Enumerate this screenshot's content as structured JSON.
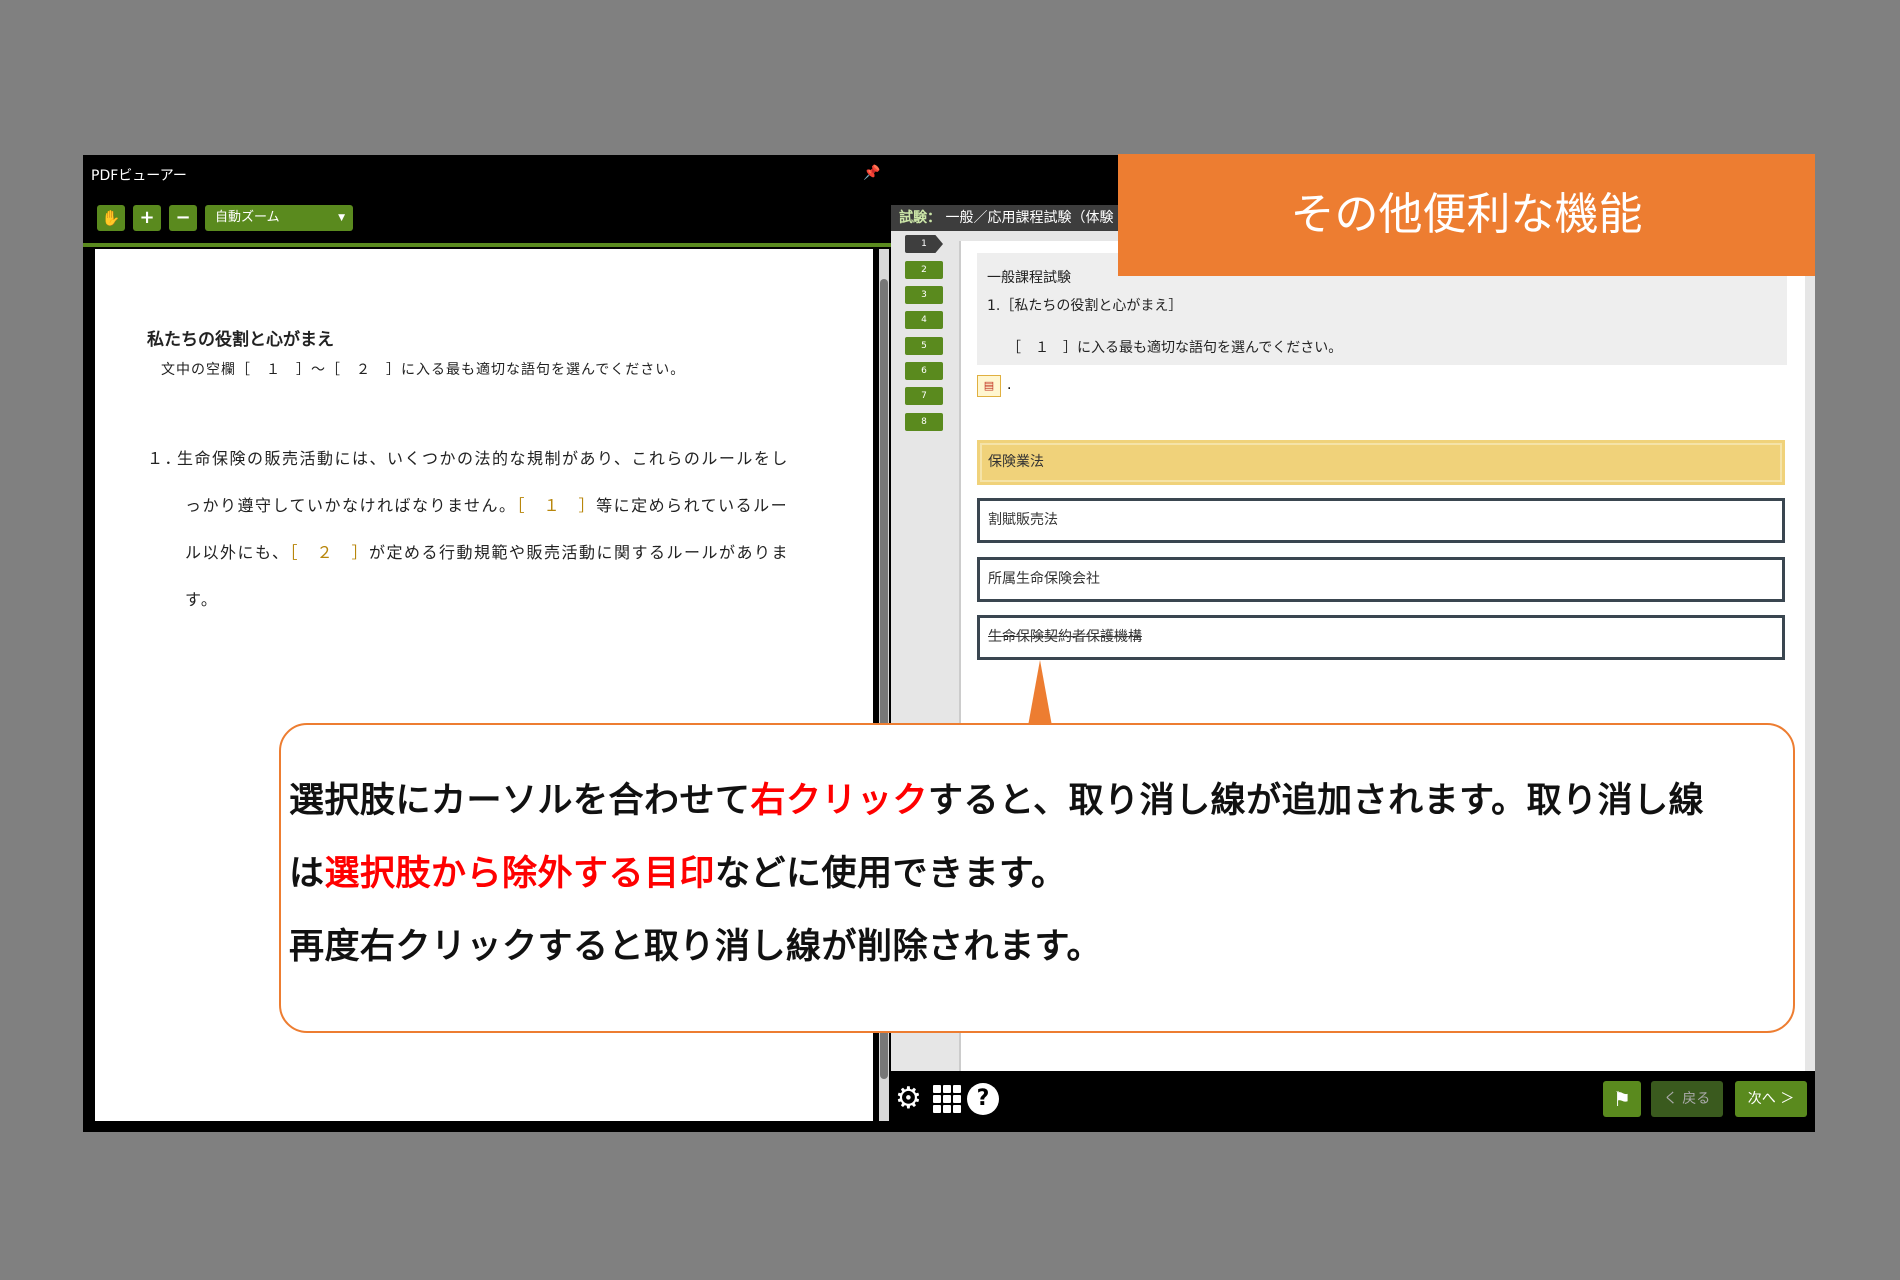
{
  "banner": {
    "title": "その他便利な機能"
  },
  "pdf_viewer": {
    "title": "PDFビューアー",
    "pin_icon": "pin-icon",
    "toolbar": {
      "hand_icon": "hand-icon",
      "zoom_in": "+",
      "zoom_out": "−",
      "zoom_select": "自動ズーム"
    },
    "page": {
      "heading": "私たちの役割と心がまえ",
      "instruction": "文中の空欄［　１　］～［　２　］に入る最も適切な語句を選んでください。",
      "item_number": "１．",
      "line1": "生命保険の販売活動には、いくつかの法的な規制があり、これらのルールをし",
      "line2a": "っかり遵守していかなければなりません。",
      "blank1": "［　１　］",
      "line2b": "等に定められているルー",
      "line3a": "ル以外にも、",
      "blank2": "［　２　］",
      "line3b": "が定める行動規範や販売活動に関するルールがありま",
      "line4": "す。"
    }
  },
  "exam": {
    "header_label": "試験：",
    "header_title": "一般／応用課程試験（体験",
    "question_nav": [
      "1",
      "2",
      "3",
      "4",
      "5",
      "6",
      "7",
      "8"
    ],
    "question": {
      "category": "一般課程試験",
      "title": "1.［私たちの役割と心がまえ］",
      "text": "［　１　］に入る最も適切な語句を選んでください。",
      "pdf_icon": "pdf-icon",
      "pdf_suffix": "."
    },
    "choices": [
      {
        "label": "保険業法",
        "state": "selected"
      },
      {
        "label": "割賦販売法",
        "state": "normal"
      },
      {
        "label": "所属生命保険会社",
        "state": "normal"
      },
      {
        "label": "生命保険契約者保護機構",
        "state": "struck"
      }
    ],
    "footer": {
      "settings_icon": "gear-icon",
      "grid_icon": "grid-icon",
      "help": "?",
      "flag_icon": "flag-icon",
      "back": "く 戻る",
      "next": "次へ ＞"
    }
  },
  "callout": {
    "line1_a": "選択肢にカーソルを合わせて",
    "line1_red": "右クリック",
    "line1_b": "すると、取り消し線が追加されます。取り消し線",
    "line2_a": "は",
    "line2_red": "選択肢から除外する目印",
    "line2_b": "などに使用できます。",
    "line3": "再度右クリックすると取り消し線が削除されます。"
  },
  "colors": {
    "accent_green": "#5a8a1e",
    "banner_orange": "#ed7d31",
    "highlight_red": "#ff0000",
    "selected_choice": "#f0d27a"
  }
}
